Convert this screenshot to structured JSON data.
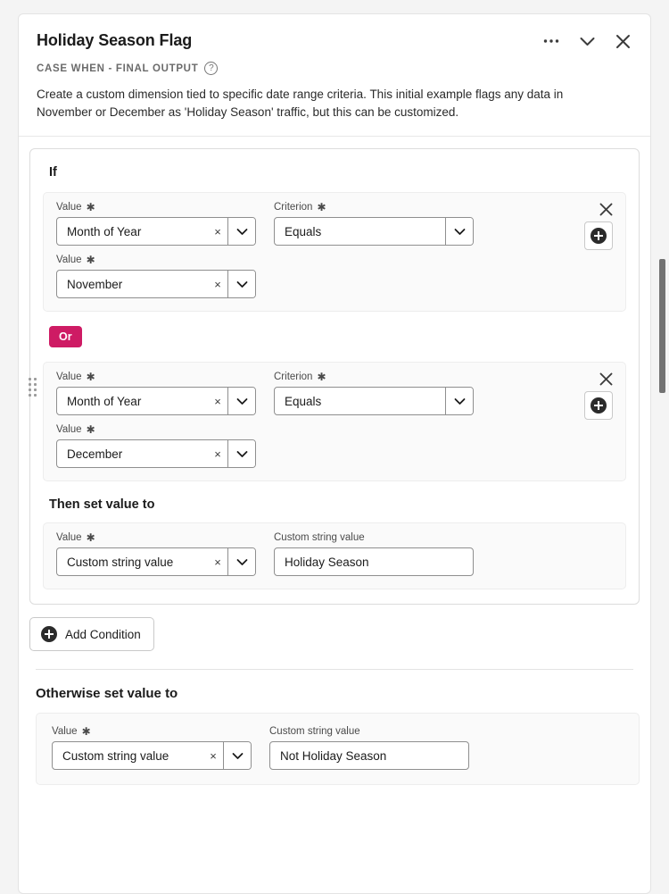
{
  "header": {
    "title": "Holiday Season Flag",
    "subtitle": "CASE WHEN - FINAL OUTPUT",
    "help_icon": "question-mark-circle-icon",
    "menu_icon": "ellipsis-icon",
    "collapse_icon": "chevron-down-icon",
    "close_icon": "close-icon",
    "description": "Create a custom dimension tied to specific date range criteria. This initial example flags any data in November or December as 'Holiday Season' traffic, but this can be customized."
  },
  "if_section": {
    "heading": "If",
    "conditions": [
      {
        "value_label": "Value",
        "value_field": "Month of Year",
        "criterion_label": "Criterion",
        "criterion_field": "Equals",
        "second_value_label": "Value",
        "second_value_field": "November"
      },
      {
        "value_label": "Value",
        "value_field": "Month of Year",
        "criterion_label": "Criterion",
        "criterion_field": "Equals",
        "second_value_label": "Value",
        "second_value_field": "December"
      }
    ],
    "operator_chip": "Or",
    "then_heading": "Then set value to",
    "then": {
      "value_label": "Value",
      "value_field": "Custom string value",
      "custom_label": "Custom string value",
      "custom_value": "Holiday Season"
    }
  },
  "add_condition": {
    "label": "Add Condition",
    "icon": "plus-circle-icon"
  },
  "otherwise": {
    "heading": "Otherwise set value to",
    "value_label": "Value",
    "value_field": "Custom string value",
    "custom_label": "Custom string value",
    "custom_value": "Not Holiday Season"
  },
  "colors": {
    "accent_chip": "#ce1b64",
    "card_background": "#ffffff",
    "page_background": "#f4f4f4",
    "field_border": "#8f8f8f"
  },
  "glyphs": {
    "clear": "×",
    "help": "?",
    "close": "✕"
  }
}
